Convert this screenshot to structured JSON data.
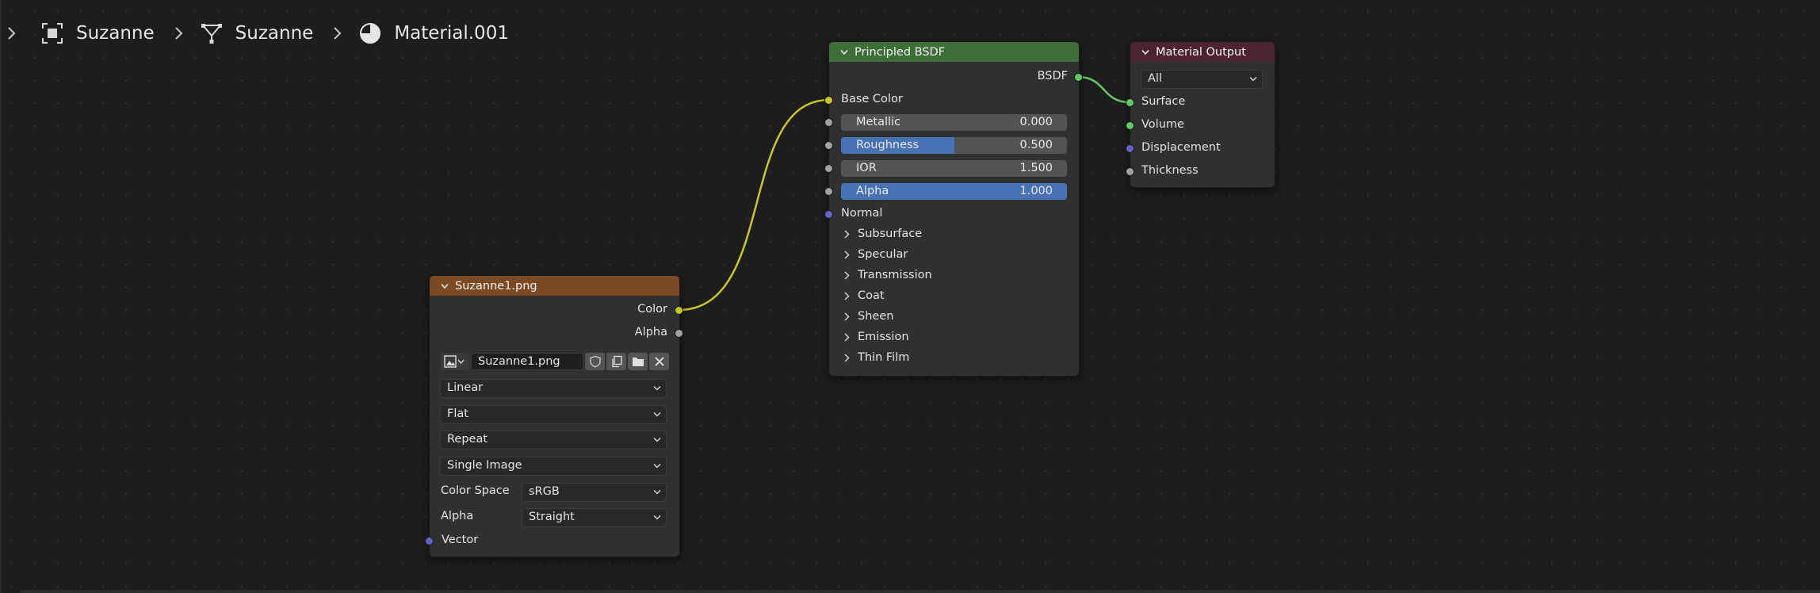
{
  "breadcrumb": {
    "items": [
      {
        "label": "Suzanne",
        "icon": "object-icon"
      },
      {
        "label": "Suzanne",
        "icon": "mesh-icon"
      },
      {
        "label": "Material.001",
        "icon": "material-icon"
      }
    ]
  },
  "principled": {
    "title": "Principled BSDF",
    "output": "BSDF",
    "base_color": "Base Color",
    "sliders": [
      {
        "label": "Metallic",
        "value": "0.000",
        "fill": 0.0
      },
      {
        "label": "Roughness",
        "value": "0.500",
        "fill": 0.5
      },
      {
        "label": "IOR",
        "value": "1.500",
        "fill": 0.0
      },
      {
        "label": "Alpha",
        "value": "1.000",
        "fill": 1.0
      }
    ],
    "normal": "Normal",
    "panels": [
      "Subsurface",
      "Specular",
      "Transmission",
      "Coat",
      "Sheen",
      "Emission",
      "Thin Film"
    ]
  },
  "material_output": {
    "title": "Material Output",
    "target": "All",
    "inputs": [
      "Surface",
      "Volume",
      "Displacement",
      "Thickness"
    ]
  },
  "image_texture": {
    "title": "Suzanne1.png",
    "outputs": [
      "Color",
      "Alpha"
    ],
    "image_name": "Suzanne1.png",
    "interpolation": "Linear",
    "projection": "Flat",
    "extension": "Repeat",
    "source": "Single Image",
    "color_space_label": "Color Space",
    "color_space": "sRGB",
    "alpha_label": "Alpha",
    "alpha_mode": "Straight",
    "vector": "Vector"
  },
  "colors": {
    "background": "#1d1d1d",
    "node_body": "#303030",
    "shader_header": "#3d6e38",
    "texture_header": "#7b4a22",
    "output_header": "#4b2332",
    "slider_fill": "#4772b3",
    "color_socket": "#c7c729",
    "float_socket": "#a1a1a1",
    "vector_socket": "#6363c7",
    "shader_socket": "#63c763"
  }
}
